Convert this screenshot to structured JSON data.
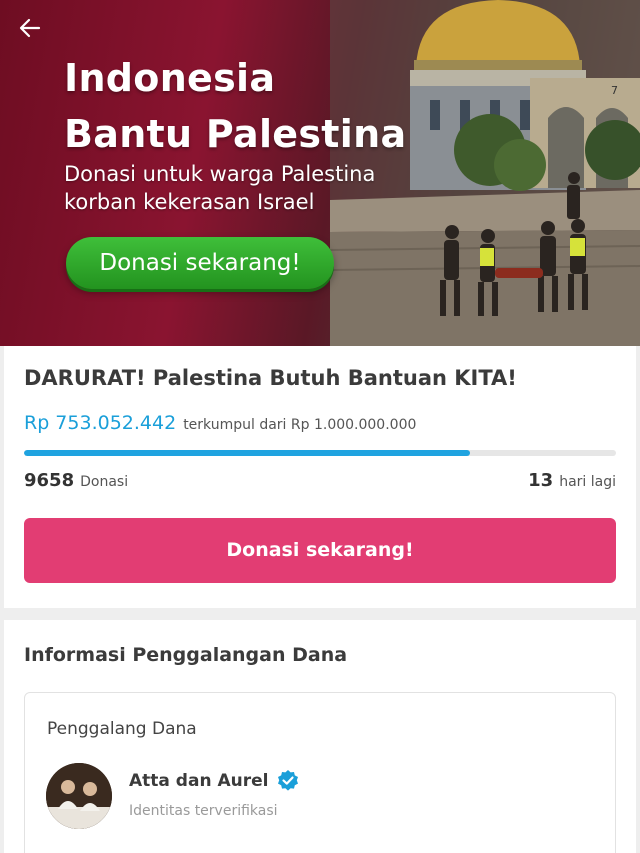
{
  "banner": {
    "title_line1": "Indonesia",
    "title_line2": "Bantu Palestina",
    "subtitle": "Donasi untuk warga Palestina korban kekerasan Israel",
    "cta_label": "Donasi sekarang!",
    "sign_number": "7"
  },
  "navigation": {
    "back_icon": "arrow-left-icon"
  },
  "campaign": {
    "title": "DARURAT! Palestina Butuh Bantuan KITA!",
    "raised_amount": "Rp 753.052.442",
    "raised_of": "terkumpul dari Rp 1.000.000.000",
    "progress_fraction": 0.753,
    "donation_count": "9658",
    "donation_label": "Donasi",
    "days_left": "13",
    "days_label": "hari lagi",
    "donate_label": "Donasi sekarang!"
  },
  "info": {
    "section_title": "Informasi Penggalangan Dana",
    "fundraiser_label": "Penggalang Dana",
    "fundraiser_name": "Atta dan Aurel",
    "fundraiser_status": "Identitas terverifikasi",
    "verified_icon": "verified-badge-icon"
  },
  "colors": {
    "accent_blue": "#1a9fd9",
    "donate_pink": "#e23d73",
    "banner_green": "#2fa62b",
    "banner_maroon": "#8a1430"
  }
}
